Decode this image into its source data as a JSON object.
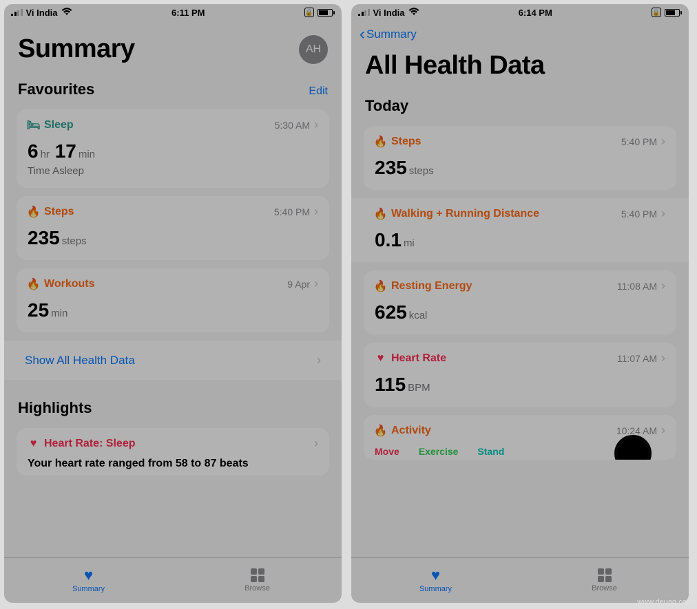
{
  "left": {
    "status": {
      "carrier": "Vi India",
      "time": "6:11 PM"
    },
    "title": "Summary",
    "avatar": "AH",
    "section": "Favourites",
    "edit": "Edit",
    "cards": {
      "sleep": {
        "title": "Sleep",
        "time": "5:30 AM",
        "hr": "6",
        "hr_u": "hr",
        "min": "17",
        "min_u": "min",
        "sub": "Time Asleep"
      },
      "steps": {
        "title": "Steps",
        "time": "5:40 PM",
        "val": "235",
        "unit": "steps"
      },
      "workouts": {
        "title": "Workouts",
        "time": "9 Apr",
        "val": "25",
        "unit": "min"
      }
    },
    "show_all": "Show All Health Data",
    "highlights": "Highlights",
    "hr_sleep": {
      "title": "Heart Rate: Sleep",
      "text": "Your heart rate ranged from 58 to 87 beats"
    },
    "tabs": {
      "summary": "Summary",
      "browse": "Browse"
    }
  },
  "right": {
    "status": {
      "carrier": "Vi India",
      "time": "6:14 PM"
    },
    "back": "Summary",
    "title": "All Health Data",
    "section": "Today",
    "cards": {
      "steps": {
        "title": "Steps",
        "time": "5:40 PM",
        "val": "235",
        "unit": "steps"
      },
      "walk": {
        "title": "Walking + Running Distance",
        "time": "5:40 PM",
        "val": "0.1",
        "unit": "mi"
      },
      "rest": {
        "title": "Resting Energy",
        "time": "11:08 AM",
        "val": "625",
        "unit": "kcal"
      },
      "hr": {
        "title": "Heart Rate",
        "time": "11:07 AM",
        "val": "115",
        "unit": "BPM"
      },
      "activity": {
        "title": "Activity",
        "time": "10:24 AM",
        "move": "Move",
        "exercise": "Exercise",
        "stand": "Stand"
      }
    },
    "tabs": {
      "summary": "Summary",
      "browse": "Browse"
    }
  },
  "watermark": "www.deuaq.com"
}
